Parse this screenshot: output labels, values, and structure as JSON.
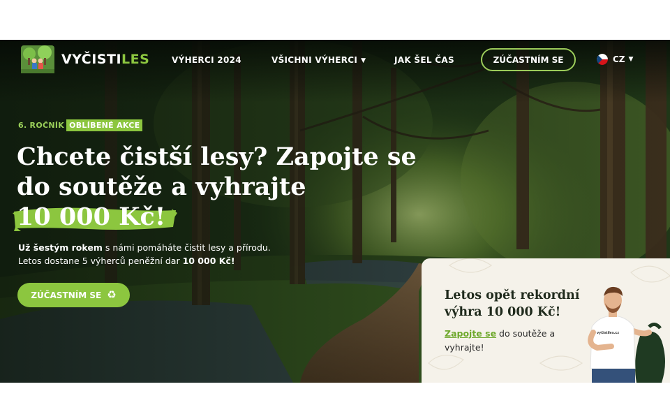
{
  "header": {
    "logo_text_main": "VYČISTI",
    "logo_text_accent": "LES",
    "nav": {
      "winners_2024": "VÝHERCI 2024",
      "all_winners": "VŠICHNI VÝHERCI",
      "timeline": "JAK ŠEL ČAS"
    },
    "cta_label": "ZÚČASTNÍM SE",
    "language": "CZ"
  },
  "hero": {
    "badge_year": "6. ROČNÍK",
    "badge_popular": "OBLÍBENÉ AKCE",
    "headline_line1": "Chcete čistší lesy? Zapojte se",
    "headline_line2": "do soutěže a vyhrajte",
    "headline_amount": "10 000 Kč!",
    "lead_bold": "Už šestým rokem",
    "lead_text": " s námi pomáháte čistit lesy a přírodu. Letos dostane 5 výherců peněžní dar ",
    "lead_amount": "10 000 Kč!",
    "cta_label": "ZÚČASTNÍM SE"
  },
  "promo": {
    "title": "Letos opět rekordní výhra 10 000 Kč!",
    "link_text": "Zapojte se",
    "text": " do soutěže a vyhrajte!",
    "shirt_text": "vyčistiles.cz"
  },
  "colors": {
    "brand_green": "#8cc63f",
    "promo_bg": "#f5f2ea",
    "forest_dark": "#13200f"
  },
  "icons": {
    "logo": "volunteers-forest-logo",
    "dropdown": "caret-down-icon",
    "flag": "czech-flag-icon",
    "cta": "recycle-icon"
  }
}
